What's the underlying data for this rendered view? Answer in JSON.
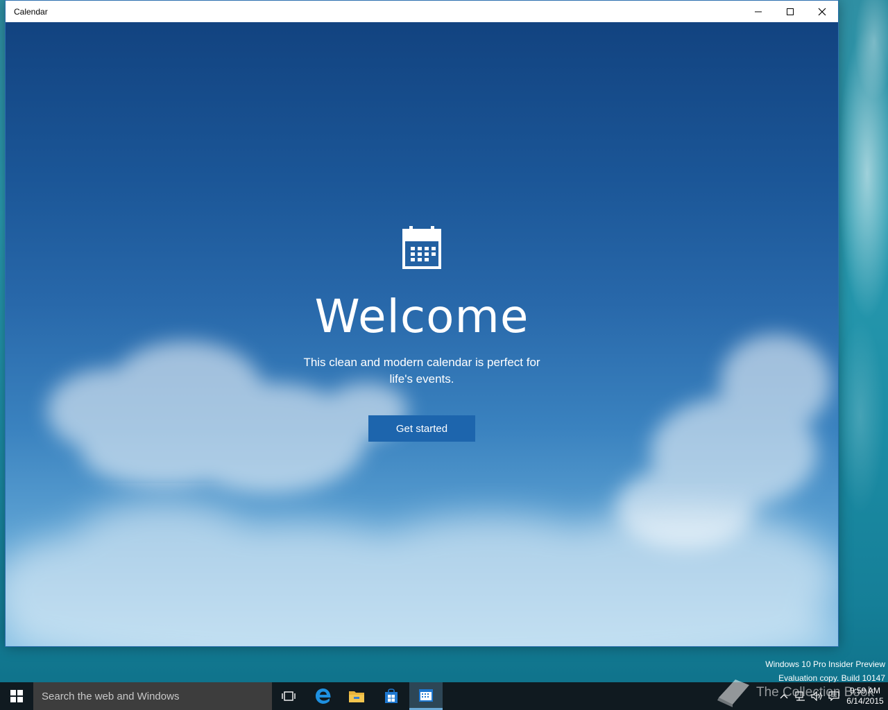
{
  "window": {
    "title": "Calendar"
  },
  "welcome": {
    "heading": "Welcome",
    "description": "This clean and modern calendar is perfect for life's events.",
    "button_label": "Get started"
  },
  "watermark": {
    "line1": "Windows 10 Pro Insider Preview",
    "line2": "Evaluation copy. Build 10147"
  },
  "taskbar": {
    "search_placeholder": "Search the web and Windows",
    "pinned": [
      "task-view",
      "edge",
      "file-explorer",
      "store",
      "calendar"
    ],
    "clock_time": "9:59 AM",
    "clock_date": "6/14/2015"
  },
  "overlay_logo": {
    "text": "The Collection Book"
  },
  "colors": {
    "accent": "#1d65ad",
    "taskbar": "#101a20",
    "search": "#3d3d3d"
  }
}
